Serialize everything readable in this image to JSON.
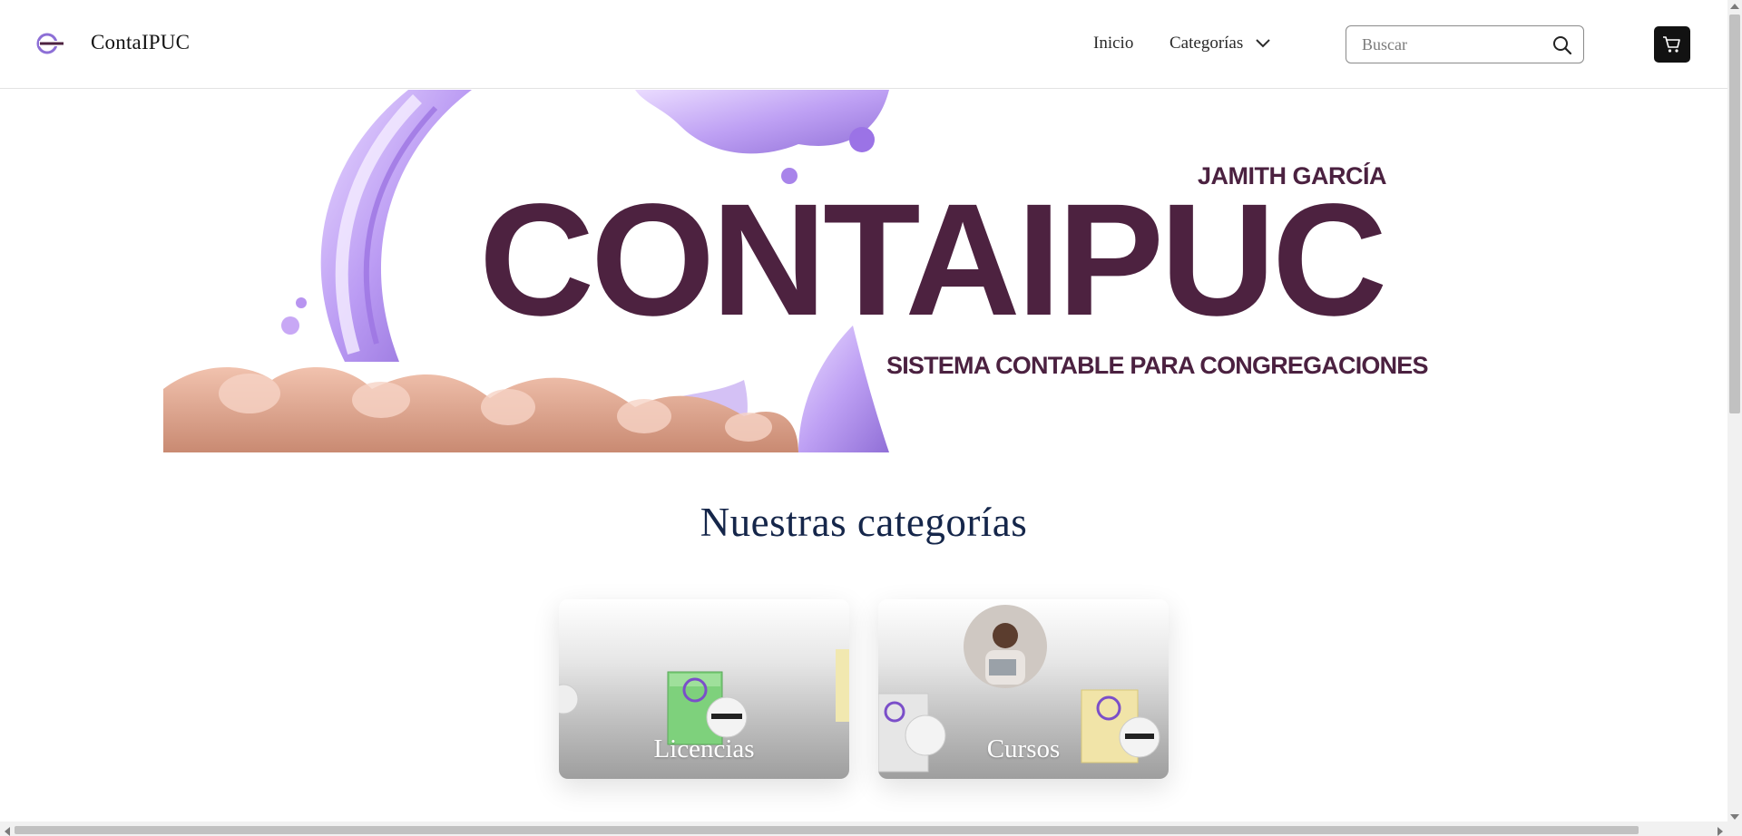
{
  "header": {
    "brand": "ContaIPUC",
    "logo_icon": "contaipuc-logo-icon",
    "nav": {
      "inicio": "Inicio",
      "categorias": "Categorías"
    },
    "search": {
      "placeholder": "Buscar",
      "value": ""
    },
    "cart_icon": "shopping-cart-icon"
  },
  "hero": {
    "author": "JAMITH GARCÍA",
    "title": "CONTAIPUC",
    "subtitle": "SISTEMA CONTABLE PARA CONGREGACIONES",
    "colors": {
      "text": "#4d2240",
      "splash": "#b89cf0"
    }
  },
  "categories": {
    "title": "Nuestras categorías",
    "items": [
      {
        "label": "Licencias"
      },
      {
        "label": "Cursos"
      }
    ]
  },
  "colors": {
    "brand_dark": "#121212",
    "heading": "#15264a"
  }
}
